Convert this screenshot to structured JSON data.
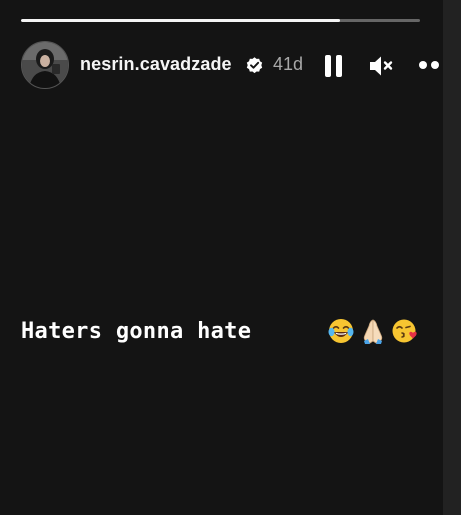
{
  "story": {
    "progress_fraction": 0.8,
    "user": {
      "username": "nesrin.cavadzade",
      "verified": true,
      "posted_ago": "41d",
      "avatar": "profile-photo"
    },
    "controls": {
      "pause_icon": "pause-icon",
      "mute_icon": "volume-muted-icon",
      "more_icon": "more-options-icon"
    },
    "caption": {
      "text": "Haters gonna hate",
      "emojis": [
        "face-with-tears-of-joy-emoji",
        "folded-hands-emoji",
        "face-blowing-a-kiss-emoji"
      ]
    }
  },
  "colors": {
    "background": "#141414",
    "text": "#ffffff",
    "muted_text": "#a8a8a8",
    "progress_track": "#5a5a5a",
    "progress_fill": "#f4f4f4"
  }
}
